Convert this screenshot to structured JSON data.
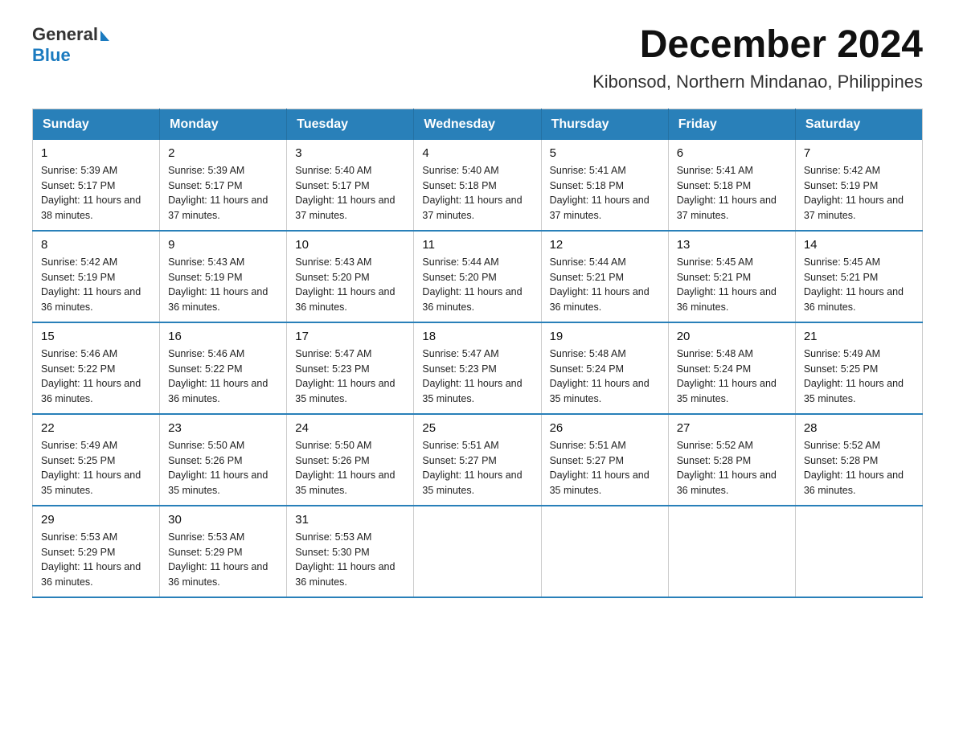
{
  "header": {
    "logo": {
      "text_general": "General",
      "text_blue": "Blue"
    },
    "month_title": "December 2024",
    "location": "Kibonsod, Northern Mindanao, Philippines"
  },
  "weekdays": [
    "Sunday",
    "Monday",
    "Tuesday",
    "Wednesday",
    "Thursday",
    "Friday",
    "Saturday"
  ],
  "weeks": [
    [
      {
        "day": "1",
        "sunrise": "Sunrise: 5:39 AM",
        "sunset": "Sunset: 5:17 PM",
        "daylight": "Daylight: 11 hours and 38 minutes."
      },
      {
        "day": "2",
        "sunrise": "Sunrise: 5:39 AM",
        "sunset": "Sunset: 5:17 PM",
        "daylight": "Daylight: 11 hours and 37 minutes."
      },
      {
        "day": "3",
        "sunrise": "Sunrise: 5:40 AM",
        "sunset": "Sunset: 5:17 PM",
        "daylight": "Daylight: 11 hours and 37 minutes."
      },
      {
        "day": "4",
        "sunrise": "Sunrise: 5:40 AM",
        "sunset": "Sunset: 5:18 PM",
        "daylight": "Daylight: 11 hours and 37 minutes."
      },
      {
        "day": "5",
        "sunrise": "Sunrise: 5:41 AM",
        "sunset": "Sunset: 5:18 PM",
        "daylight": "Daylight: 11 hours and 37 minutes."
      },
      {
        "day": "6",
        "sunrise": "Sunrise: 5:41 AM",
        "sunset": "Sunset: 5:18 PM",
        "daylight": "Daylight: 11 hours and 37 minutes."
      },
      {
        "day": "7",
        "sunrise": "Sunrise: 5:42 AM",
        "sunset": "Sunset: 5:19 PM",
        "daylight": "Daylight: 11 hours and 37 minutes."
      }
    ],
    [
      {
        "day": "8",
        "sunrise": "Sunrise: 5:42 AM",
        "sunset": "Sunset: 5:19 PM",
        "daylight": "Daylight: 11 hours and 36 minutes."
      },
      {
        "day": "9",
        "sunrise": "Sunrise: 5:43 AM",
        "sunset": "Sunset: 5:19 PM",
        "daylight": "Daylight: 11 hours and 36 minutes."
      },
      {
        "day": "10",
        "sunrise": "Sunrise: 5:43 AM",
        "sunset": "Sunset: 5:20 PM",
        "daylight": "Daylight: 11 hours and 36 minutes."
      },
      {
        "day": "11",
        "sunrise": "Sunrise: 5:44 AM",
        "sunset": "Sunset: 5:20 PM",
        "daylight": "Daylight: 11 hours and 36 minutes."
      },
      {
        "day": "12",
        "sunrise": "Sunrise: 5:44 AM",
        "sunset": "Sunset: 5:21 PM",
        "daylight": "Daylight: 11 hours and 36 minutes."
      },
      {
        "day": "13",
        "sunrise": "Sunrise: 5:45 AM",
        "sunset": "Sunset: 5:21 PM",
        "daylight": "Daylight: 11 hours and 36 minutes."
      },
      {
        "day": "14",
        "sunrise": "Sunrise: 5:45 AM",
        "sunset": "Sunset: 5:21 PM",
        "daylight": "Daylight: 11 hours and 36 minutes."
      }
    ],
    [
      {
        "day": "15",
        "sunrise": "Sunrise: 5:46 AM",
        "sunset": "Sunset: 5:22 PM",
        "daylight": "Daylight: 11 hours and 36 minutes."
      },
      {
        "day": "16",
        "sunrise": "Sunrise: 5:46 AM",
        "sunset": "Sunset: 5:22 PM",
        "daylight": "Daylight: 11 hours and 36 minutes."
      },
      {
        "day": "17",
        "sunrise": "Sunrise: 5:47 AM",
        "sunset": "Sunset: 5:23 PM",
        "daylight": "Daylight: 11 hours and 35 minutes."
      },
      {
        "day": "18",
        "sunrise": "Sunrise: 5:47 AM",
        "sunset": "Sunset: 5:23 PM",
        "daylight": "Daylight: 11 hours and 35 minutes."
      },
      {
        "day": "19",
        "sunrise": "Sunrise: 5:48 AM",
        "sunset": "Sunset: 5:24 PM",
        "daylight": "Daylight: 11 hours and 35 minutes."
      },
      {
        "day": "20",
        "sunrise": "Sunrise: 5:48 AM",
        "sunset": "Sunset: 5:24 PM",
        "daylight": "Daylight: 11 hours and 35 minutes."
      },
      {
        "day": "21",
        "sunrise": "Sunrise: 5:49 AM",
        "sunset": "Sunset: 5:25 PM",
        "daylight": "Daylight: 11 hours and 35 minutes."
      }
    ],
    [
      {
        "day": "22",
        "sunrise": "Sunrise: 5:49 AM",
        "sunset": "Sunset: 5:25 PM",
        "daylight": "Daylight: 11 hours and 35 minutes."
      },
      {
        "day": "23",
        "sunrise": "Sunrise: 5:50 AM",
        "sunset": "Sunset: 5:26 PM",
        "daylight": "Daylight: 11 hours and 35 minutes."
      },
      {
        "day": "24",
        "sunrise": "Sunrise: 5:50 AM",
        "sunset": "Sunset: 5:26 PM",
        "daylight": "Daylight: 11 hours and 35 minutes."
      },
      {
        "day": "25",
        "sunrise": "Sunrise: 5:51 AM",
        "sunset": "Sunset: 5:27 PM",
        "daylight": "Daylight: 11 hours and 35 minutes."
      },
      {
        "day": "26",
        "sunrise": "Sunrise: 5:51 AM",
        "sunset": "Sunset: 5:27 PM",
        "daylight": "Daylight: 11 hours and 35 minutes."
      },
      {
        "day": "27",
        "sunrise": "Sunrise: 5:52 AM",
        "sunset": "Sunset: 5:28 PM",
        "daylight": "Daylight: 11 hours and 36 minutes."
      },
      {
        "day": "28",
        "sunrise": "Sunrise: 5:52 AM",
        "sunset": "Sunset: 5:28 PM",
        "daylight": "Daylight: 11 hours and 36 minutes."
      }
    ],
    [
      {
        "day": "29",
        "sunrise": "Sunrise: 5:53 AM",
        "sunset": "Sunset: 5:29 PM",
        "daylight": "Daylight: 11 hours and 36 minutes."
      },
      {
        "day": "30",
        "sunrise": "Sunrise: 5:53 AM",
        "sunset": "Sunset: 5:29 PM",
        "daylight": "Daylight: 11 hours and 36 minutes."
      },
      {
        "day": "31",
        "sunrise": "Sunrise: 5:53 AM",
        "sunset": "Sunset: 5:30 PM",
        "daylight": "Daylight: 11 hours and 36 minutes."
      },
      null,
      null,
      null,
      null
    ]
  ]
}
